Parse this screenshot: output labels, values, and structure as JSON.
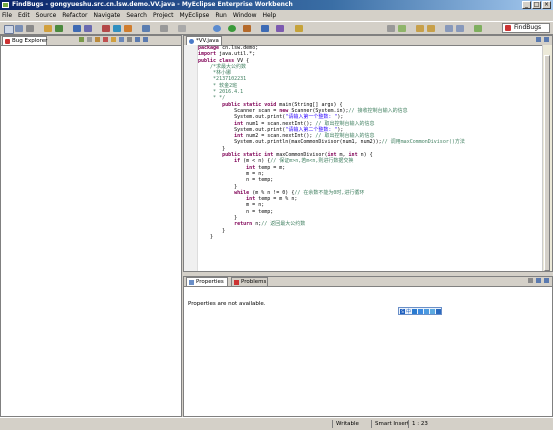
{
  "window": {
    "title": "FindBugs - gongyueshu.src.cn.lsw.demo.VV.java - MyEclipse Enterprise Workbench"
  },
  "menu": [
    "File",
    "Edit",
    "Source",
    "Refactor",
    "Navigate",
    "Search",
    "Project",
    "MyEclipse",
    "Run",
    "Window",
    "Help"
  ],
  "perspective": {
    "label": "FindBugs"
  },
  "left_panel": {
    "tab_label": "Bug Explorer"
  },
  "editor": {
    "tab_label": "*VV.java",
    "lines": [
      {
        "parts": [
          {
            "t": "package ",
            "c": "kw"
          },
          {
            "t": "cn.lsw.demo;"
          }
        ]
      },
      {
        "parts": [
          {
            "t": "import ",
            "c": "kw"
          },
          {
            "t": "java.util.*;"
          }
        ]
      },
      {
        "parts": [
          {
            "t": "public class ",
            "c": "kw"
          },
          {
            "t": "VV {"
          }
        ]
      },
      {
        "parts": [
          {
            "t": "    /*求最大公约数",
            "c": "cm"
          }
        ]
      },
      {
        "parts": [
          {
            "t": "     *林小娜",
            "c": "cm"
          }
        ]
      },
      {
        "parts": [
          {
            "t": "     *2137102231",
            "c": "cm"
          }
        ]
      },
      {
        "parts": [
          {
            "t": "     * 软金2班",
            "c": "cm"
          }
        ]
      },
      {
        "parts": [
          {
            "t": "     * 2016.4.1",
            "c": "cm"
          }
        ]
      },
      {
        "parts": [
          {
            "t": "     * */",
            "c": "cm"
          }
        ]
      },
      {
        "parts": [
          {
            "t": "        "
          },
          {
            "t": "public static void ",
            "c": "kw"
          },
          {
            "t": "main(String[] args) {"
          }
        ]
      },
      {
        "parts": [
          {
            "t": "            Scanner scan = "
          },
          {
            "t": "new ",
            "c": "kw"
          },
          {
            "t": "Scanner(System.in);"
          },
          {
            "t": "// 接收控制台输入的信息",
            "c": "cm"
          }
        ]
      },
      {
        "parts": [
          {
            "t": "            System.out.print("
          },
          {
            "t": "\"请输入第一个整数: \"",
            "c": "st"
          },
          {
            "t": ");"
          }
        ]
      },
      {
        "parts": [
          {
            "t": "            "
          },
          {
            "t": "int ",
            "c": "kw"
          },
          {
            "t": "num1 = scan.nextInt(); "
          },
          {
            "t": "// 取出控制台输入的信息",
            "c": "cm"
          }
        ]
      },
      {
        "parts": [
          {
            "t": "            System.out.print("
          },
          {
            "t": "\"请输入第二个整数: \"",
            "c": "st"
          },
          {
            "t": ");"
          }
        ]
      },
      {
        "parts": [
          {
            "t": "            "
          },
          {
            "t": "int ",
            "c": "kw"
          },
          {
            "t": "num2 = scan.nextInt(); "
          },
          {
            "t": "// 取出控制台输入的信息",
            "c": "cm"
          }
        ]
      },
      {
        "parts": [
          {
            "t": "            System.out.println(maxCommonDivisor(num1, num2));"
          },
          {
            "t": "// 调用maxCommonDivisor()方法",
            "c": "cm"
          }
        ]
      },
      {
        "parts": [
          {
            "t": "        }"
          }
        ]
      },
      {
        "parts": [
          {
            "t": "        "
          },
          {
            "t": "public static int ",
            "c": "kw"
          },
          {
            "t": "maxCommonDivisor("
          },
          {
            "t": "int ",
            "c": "kw"
          },
          {
            "t": "m, "
          },
          {
            "t": "int ",
            "c": "kw"
          },
          {
            "t": "n) {"
          }
        ]
      },
      {
        "parts": [
          {
            "t": "            "
          },
          {
            "t": "if ",
            "c": "kw"
          },
          {
            "t": "(m < n) {"
          },
          {
            "t": "// 保证m>n,若m<n,则进行数据交换",
            "c": "cm"
          }
        ]
      },
      {
        "parts": [
          {
            "t": "                "
          },
          {
            "t": "int ",
            "c": "kw"
          },
          {
            "t": "temp = m;"
          }
        ]
      },
      {
        "parts": [
          {
            "t": "                m = n;"
          }
        ]
      },
      {
        "parts": [
          {
            "t": "                n = temp;"
          }
        ]
      },
      {
        "parts": [
          {
            "t": "            }"
          }
        ]
      },
      {
        "parts": [
          {
            "t": "            "
          },
          {
            "t": "while ",
            "c": "kw"
          },
          {
            "t": "(m % n != 0) {"
          },
          {
            "t": "// 在余数不能为0时,进行循环",
            "c": "cm"
          }
        ]
      },
      {
        "parts": [
          {
            "t": "                "
          },
          {
            "t": "int ",
            "c": "kw"
          },
          {
            "t": "temp = m % n;"
          }
        ]
      },
      {
        "parts": [
          {
            "t": "                m = n;"
          }
        ]
      },
      {
        "parts": [
          {
            "t": "                n = temp;"
          }
        ]
      },
      {
        "parts": [
          {
            "t": "            }"
          }
        ]
      },
      {
        "parts": [
          {
            "t": "            "
          },
          {
            "t": "return ",
            "c": "kw"
          },
          {
            "t": "n;"
          },
          {
            "t": "// 返回最大公约数",
            "c": "cm"
          }
        ]
      },
      {
        "parts": [
          {
            "t": "        }"
          }
        ]
      },
      {
        "parts": [
          {
            "t": "    }"
          }
        ]
      }
    ]
  },
  "bottom_panel": {
    "tabs": [
      "Properties",
      "Problems"
    ],
    "message": "Properties are not available."
  },
  "ime_bar": {
    "label": "中"
  },
  "status": {
    "writable": "Writable",
    "insert_mode": "Smart Insert",
    "position": "1 : 23"
  },
  "colors": {
    "keyword": "#7f0055",
    "comment": "#3f7f5f",
    "string": "#2a00ff",
    "titlebar": "#0a246a"
  }
}
